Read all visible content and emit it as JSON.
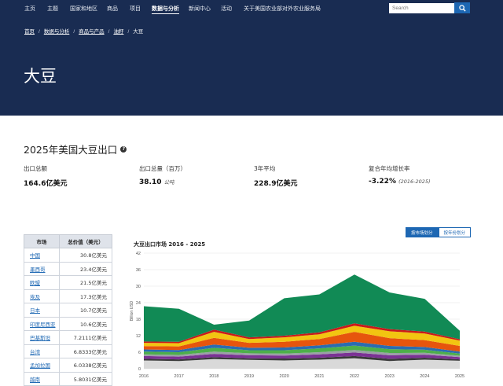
{
  "nav": {
    "items": [
      "主页",
      "主题",
      "国家和地区",
      "商品",
      "项目",
      "数据与分析",
      "新闻中心",
      "活动",
      "关于美国农业部对外农业服务局"
    ],
    "active_index": 5,
    "search_placeholder": "Search"
  },
  "breadcrumb": [
    "首页",
    "数据与分析",
    "商品与产品",
    "油籽",
    "大豆"
  ],
  "hero": {
    "title": "大豆"
  },
  "section": {
    "title": "2025年美国大豆出口"
  },
  "stats": [
    {
      "label": "出口总额",
      "value": "164.6亿美元",
      "sub": ""
    },
    {
      "label": "出口总量（百万）",
      "value": "38.10",
      "sub": "公吨"
    },
    {
      "label": "3年平均",
      "value": "228.9亿美元",
      "sub": ""
    },
    {
      "label": "复合年均增长率",
      "value": "-3.22%",
      "sub": "(2016-2025)"
    }
  ],
  "table": {
    "headers": [
      "市场",
      "总价值（美元）"
    ],
    "rows": [
      [
        "中国",
        "30.8亿美元"
      ],
      [
        "墨西哥",
        "23.4亿美元"
      ],
      [
        "欧盟",
        "21.5亿美元"
      ],
      [
        "埃及",
        "17.3亿美元"
      ],
      [
        "日本",
        "10.7亿美元"
      ],
      [
        "印度尼西亚",
        "10.6亿美元"
      ],
      [
        "巴基斯坦",
        "7.2111亿美元"
      ],
      [
        "台湾",
        "6.8333亿美元"
      ],
      [
        "孟加拉国",
        "6.0338亿美元"
      ],
      [
        "越南",
        "5.8031亿美元"
      ]
    ]
  },
  "toggles": [
    "按市场划分",
    "按年份划分"
  ],
  "colors": {
    "navy": "#192c52",
    "accent_blue": "#1d67b3",
    "series": [
      "#d9d9d9",
      "#3a3a3a",
      "#7b3294",
      "#9aa0a6",
      "#4daf4a",
      "#2b6cb0",
      "#e6550d",
      "#f2c511",
      "#ca1a1a",
      "#118a55"
    ]
  },
  "chart_data": {
    "type": "area",
    "title": "大豆出口市场 2016 - 2025",
    "ylabel": "Billion USD",
    "xlabel": "",
    "x": [
      "2016",
      "2017",
      "2018",
      "2019",
      "2020",
      "2021",
      "2022",
      "2023",
      "2024",
      "2025"
    ],
    "ylim": [
      0,
      42
    ],
    "yticks": [
      0,
      6,
      12,
      18,
      24,
      30,
      36,
      42
    ],
    "grid": true,
    "stacked": true,
    "series": [
      {
        "values": [
          3.0,
          2.8,
          3.5,
          3.2,
          3.0,
          3.3,
          3.8,
          2.8,
          3.3,
          2.9
        ]
      },
      {
        "values": [
          0.6,
          0.6,
          0.7,
          0.6,
          0.7,
          0.7,
          0.8,
          0.8,
          0.7,
          0.5
        ]
      },
      {
        "values": [
          1.0,
          1.0,
          1.2,
          1.1,
          1.1,
          1.2,
          1.3,
          1.3,
          1.1,
          0.8
        ]
      },
      {
        "values": [
          0.6,
          0.6,
          0.8,
          0.7,
          0.7,
          0.8,
          0.9,
          0.8,
          0.7,
          0.5
        ]
      },
      {
        "values": [
          1.0,
          1.0,
          1.4,
          1.1,
          1.2,
          1.4,
          1.6,
          1.4,
          1.1,
          0.8
        ]
      },
      {
        "values": [
          0.8,
          0.8,
          1.2,
          0.9,
          1.0,
          1.1,
          1.4,
          1.2,
          1.0,
          0.7
        ]
      },
      {
        "values": [
          1.2,
          1.3,
          2.4,
          1.8,
          2.1,
          2.3,
          3.6,
          2.8,
          2.5,
          2.1
        ]
      },
      {
        "values": [
          1.2,
          1.2,
          2.2,
          1.4,
          1.6,
          1.7,
          2.2,
          2.5,
          2.4,
          1.9
        ]
      },
      {
        "values": [
          0.5,
          0.5,
          0.8,
          0.6,
          0.6,
          0.7,
          0.9,
          0.8,
          0.7,
          0.5
        ]
      },
      {
        "values": [
          12.8,
          12.0,
          1.8,
          6.1,
          13.6,
          13.8,
          17.7,
          13.3,
          11.9,
          3.1
        ]
      }
    ]
  }
}
